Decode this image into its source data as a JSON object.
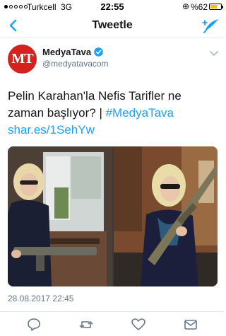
{
  "status_bar": {
    "carrier": "Turkcell",
    "network": "3G",
    "time": "22:55",
    "alarm_icon": "⊕",
    "battery_label": "%62",
    "battery_level": 0.62,
    "signal_bars_filled": 1,
    "signal_bars_total": 5
  },
  "nav": {
    "title": "Tweetle",
    "back_icon": "chevron-left-icon",
    "compose_icon": "compose-tweet-icon"
  },
  "tweet": {
    "author_name": "MedyaTava",
    "author_handle": "@medyatavacom",
    "avatar_text": "MT",
    "verified": true,
    "text_plain": "Pelin Karahan'la Nefis Tarifler ne zaman başlıyor? | ",
    "hashtag": "#MedyaTava",
    "link": "shar.es/1SehYw",
    "timestamp": "28.08.2017 22:45"
  },
  "colors": {
    "accent": "#1da1f2",
    "avatar_red": "#d6221f",
    "muted": "#657786",
    "battery": "#f2c200"
  },
  "actions": [
    "reply-icon",
    "retweet-icon",
    "like-icon",
    "share-icon"
  ]
}
